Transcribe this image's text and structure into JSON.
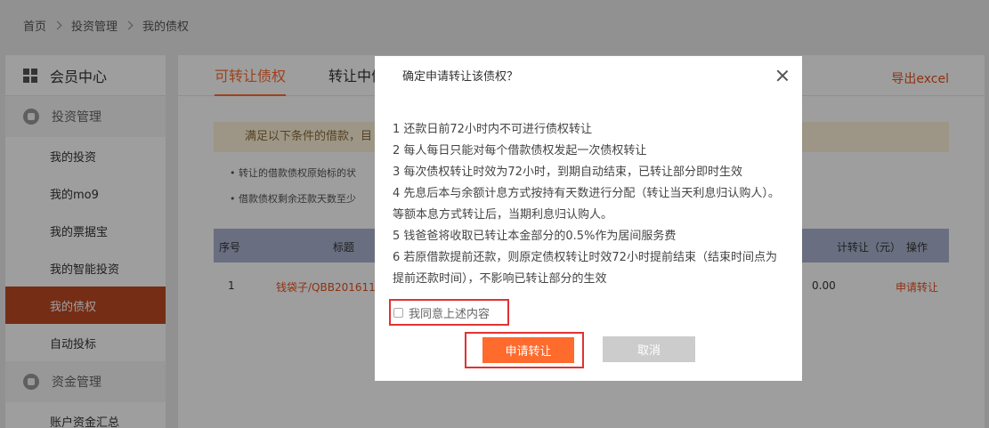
{
  "breadcrumb": [
    "首页",
    "投资管理",
    "我的债权"
  ],
  "sidebar": {
    "header": "会员中心",
    "groups": [
      {
        "label": "投资管理",
        "items": [
          "我的投资",
          "我的mo9",
          "我的票据宝",
          "我的智能投资",
          "我的债权",
          "自动投标"
        ]
      },
      {
        "label": "资金管理",
        "items": [
          "账户资金汇总"
        ]
      }
    ],
    "active_item": "我的债权"
  },
  "main": {
    "tabs": [
      "可转让债权",
      "转让中债"
    ],
    "export_label": "导出excel",
    "notice": "满足以下条件的借款，目",
    "bullets": [
      "• 转让的借款债权原始标的状",
      "• 借款债权剩余还款天数至少"
    ],
    "table": {
      "headers": [
        "序号",
        "标题",
        "计转让（元）",
        "操作"
      ],
      "rows": [
        {
          "no": "1",
          "title": "钱袋子/QBB201611",
          "amount": "0.00",
          "action": "申请转让"
        }
      ]
    }
  },
  "modal": {
    "title": "确定申请转让该债权？",
    "rules": [
      "1 还款日前72小时内不可进行债权转让",
      "2 每人每日只能对每个借款债权发起一次债权转让",
      "3 每次债权转让时效为72小时，到期自动结束，已转让部分即时生效",
      "4 先息后本与余额计息方式按持有天数进行分配（转让当天利息归认购人）。等额本息方式转让后，当期利息归认购人。",
      "5 钱爸爸将收取已转让本金部分的0.5%作为居间服务费",
      "6 若原借款提前还款，则原定债权转让时效72小时提前结束（结束时间点为提前还款时间），不影响已转让部分的生效"
    ],
    "agree_label": "我同意上述内容",
    "apply_label": "申请转让",
    "cancel_label": "取消"
  }
}
